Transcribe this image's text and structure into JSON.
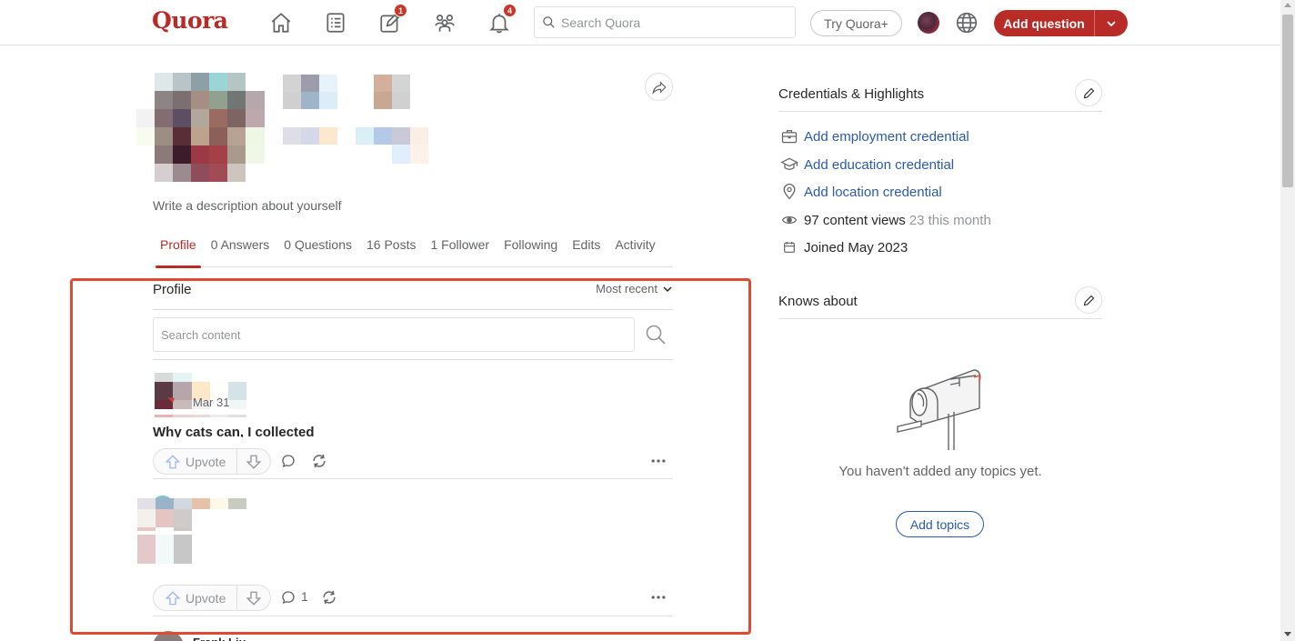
{
  "header": {
    "logo": "Quora",
    "notifications": {
      "answer_badge": "1",
      "bell_badge": "4"
    },
    "search": {
      "placeholder": "Search Quora",
      "value": ""
    },
    "try_plus": "Try Quora+",
    "add_question": "Add question"
  },
  "profile": {
    "description_placeholder": "Write a description about yourself",
    "tabs": [
      {
        "label": "Profile",
        "active": true
      },
      {
        "label": "0 Answers"
      },
      {
        "label": "0 Questions"
      },
      {
        "label": "16 Posts"
      },
      {
        "label": "1 Follower"
      },
      {
        "label": "Following"
      },
      {
        "label": "Edits"
      },
      {
        "label": "Activity"
      }
    ]
  },
  "feed": {
    "title": "Profile",
    "sort": "Most recent",
    "search_placeholder": "Search content",
    "posts": [
      {
        "date": "Mar 31",
        "title": "Why cats can, I collected",
        "upvote": "Upvote",
        "comments": ""
      },
      {
        "upvote": "Upvote",
        "comments": "1"
      }
    ],
    "next_author": "Frank Liu"
  },
  "sidebar": {
    "credentials_title": "Credentials & Highlights",
    "credentials": {
      "employment": "Add employment credential",
      "education": "Add education credential",
      "location": "Add location credential",
      "views": "97 content views",
      "views_month": "23 this month",
      "joined": "Joined May 2023"
    },
    "knows_about_title": "Knows about",
    "empty_topics": "You haven't added any topics yet.",
    "add_topics": "Add topics"
  },
  "colors": {
    "brand": "#b92b27",
    "link": "#2b5aad",
    "highlight_box": "#e04a35"
  }
}
